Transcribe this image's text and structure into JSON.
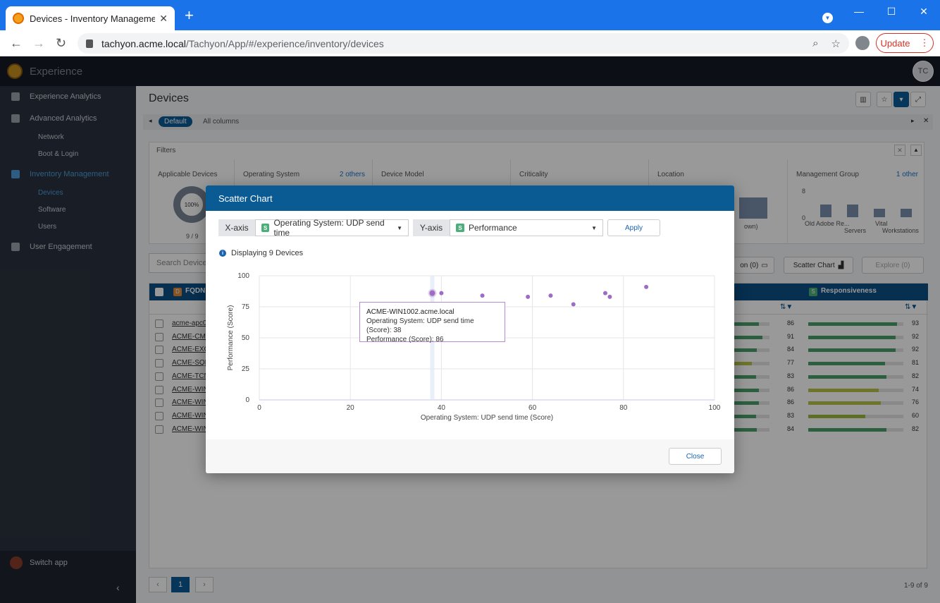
{
  "browser": {
    "tab_title": "Devices - Inventory Management",
    "url_host": "tachyon.acme.local",
    "url_path": "/Tachyon/App/#/experience/inventory/devices",
    "update_label": "Update"
  },
  "app": {
    "name": "Experience",
    "avatar_initials": "TC"
  },
  "sidebar": {
    "items": [
      {
        "label": "Experience Analytics"
      },
      {
        "label": "Advanced Analytics"
      },
      {
        "label": "Network"
      },
      {
        "label": "Boot & Login"
      },
      {
        "label": "Inventory Management"
      },
      {
        "label": "Devices"
      },
      {
        "label": "Software"
      },
      {
        "label": "Users"
      },
      {
        "label": "User Engagement"
      }
    ],
    "switch_app": "Switch app"
  },
  "page": {
    "title": "Devices",
    "view_default": "Default",
    "view_all": "All columns",
    "filters_label": "Filters",
    "filters": [
      {
        "title": "Applicable Devices",
        "other": ""
      },
      {
        "title": "Operating System",
        "other": "2 others"
      },
      {
        "title": "Device Model",
        "other": ""
      },
      {
        "title": "Criticality",
        "other": ""
      },
      {
        "title": "Location",
        "other": ""
      },
      {
        "title": "Management Group",
        "other": "1 other"
      }
    ],
    "donut_label": "100%",
    "donut_count": "9 / 9",
    "location_suffix": "own)",
    "mg_axis_top": "8",
    "mg_axis_bottom": "0",
    "mg_labels": [
      "Old Adobe Re...",
      "Servers",
      "Vital",
      "Workstations"
    ],
    "search_placeholder": "Search Device",
    "btn_compare": "on (0)",
    "btn_scatter": "Scatter Chart",
    "btn_explore": "Explore (0)",
    "col_fqdn": "FQDN",
    "col_responsiveness": "Responsiveness",
    "badge_s": "S",
    "badge_d": "D",
    "rows": [
      {
        "fqdn": "acme-apc01",
        "a": 86,
        "b": 93
      },
      {
        "fqdn": "ACME-CM01",
        "a": 91,
        "b": 92
      },
      {
        "fqdn": "ACME-EXC0",
        "a": 84,
        "b": 92
      },
      {
        "fqdn": "ACME-SQL0",
        "a": 77,
        "b": 81
      },
      {
        "fqdn": "ACME-TCN0",
        "a": 83,
        "b": 82
      },
      {
        "fqdn": "ACME-WIN1",
        "a": 86,
        "b": 74
      },
      {
        "fqdn": "ACME-WIN1",
        "a": 86,
        "b": 76
      },
      {
        "fqdn": "ACME-WIN8",
        "a": 83,
        "b": 60
      },
      {
        "fqdn": "ACME-WIN8",
        "a": 84,
        "b": 82
      }
    ],
    "pager_current": "1",
    "pager_count": "1-9 of 9"
  },
  "modal": {
    "title": "Scatter Chart",
    "x_tag": "X-axis",
    "x_select": "Operating System: UDP send time",
    "y_tag": "Y-axis",
    "y_select": "Performance",
    "apply": "Apply",
    "display_count": "Displaying 9 Devices",
    "close": "Close",
    "tooltip": {
      "title": "ACME-WIN1002.acme.local",
      "line1": "Operating System: UDP send time (Score): 38",
      "line2": "Performance (Score): 86"
    }
  },
  "chart_data": {
    "type": "scatter",
    "xlabel": "Operating System: UDP send time (Score)",
    "ylabel": "Performance (Score)",
    "xlim": [
      0,
      100
    ],
    "ylim": [
      0,
      100
    ],
    "xticks": [
      0,
      20,
      40,
      60,
      80,
      100
    ],
    "yticks": [
      0,
      25,
      50,
      75,
      100
    ],
    "grid": true,
    "color": "#9e6cc4",
    "points": [
      {
        "x": 38,
        "y": 86,
        "highlighted": true
      },
      {
        "x": 40,
        "y": 86
      },
      {
        "x": 49,
        "y": 84
      },
      {
        "x": 59,
        "y": 83
      },
      {
        "x": 64,
        "y": 84
      },
      {
        "x": 69,
        "y": 77
      },
      {
        "x": 76,
        "y": 86
      },
      {
        "x": 77,
        "y": 83
      },
      {
        "x": 85,
        "y": 91
      }
    ]
  }
}
